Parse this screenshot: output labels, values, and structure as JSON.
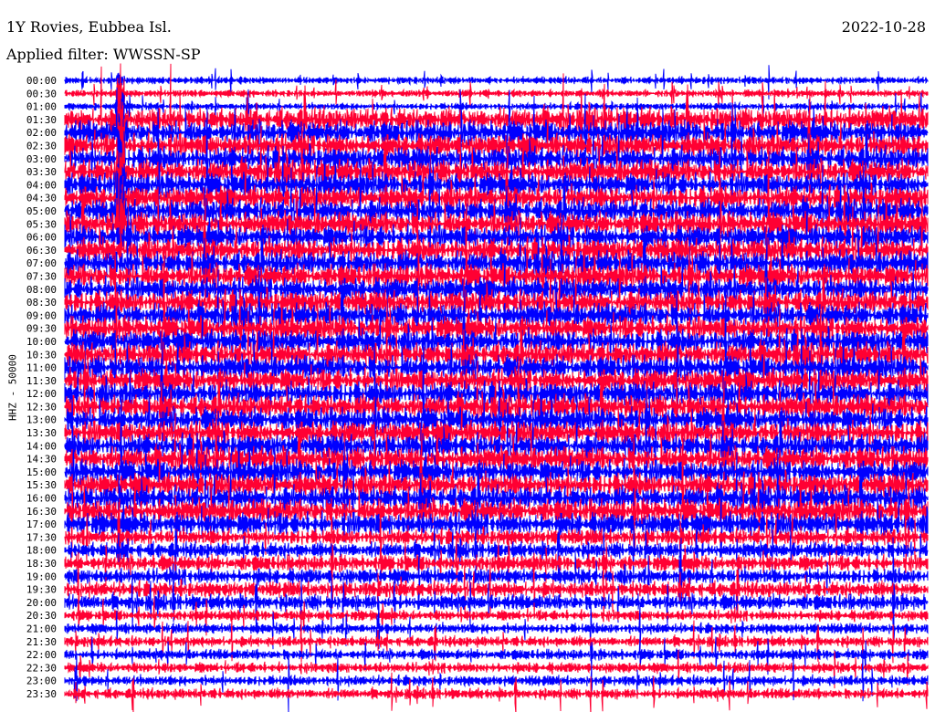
{
  "header": {
    "station": "1Y Rovies, Eubbea Isl.",
    "filter": "Applied filter: WWSSN-SP",
    "date": "2022-10-28"
  },
  "chart_data": {
    "type": "line",
    "title": "1Y Rovies, Eubbea Isl.",
    "ylabel": "HHZ - 50000",
    "row_labels": [
      "00:00",
      "00:30",
      "01:00",
      "01:30",
      "02:00",
      "02:30",
      "03:00",
      "03:30",
      "04:00",
      "04:30",
      "05:00",
      "05:30",
      "06:00",
      "06:30",
      "07:00",
      "07:30",
      "08:00",
      "08:30",
      "09:00",
      "09:30",
      "10:00",
      "10:30",
      "11:00",
      "11:30",
      "12:00",
      "12:30",
      "13:00",
      "13:30",
      "14:00",
      "14:30",
      "15:00",
      "15:30",
      "16:00",
      "16:30",
      "17:00",
      "17:30",
      "18:00",
      "18:30",
      "19:00",
      "19:30",
      "20:00",
      "20:30",
      "21:00",
      "21:30",
      "22:00",
      "22:30",
      "23:00",
      "23:30"
    ],
    "series_colors": [
      "#0000ff",
      "#ff0033"
    ],
    "grid": false,
    "legend": "none"
  }
}
